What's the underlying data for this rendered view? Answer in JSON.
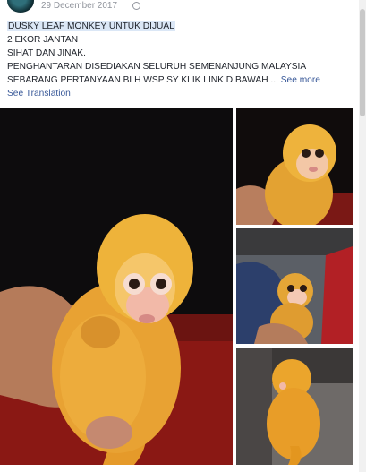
{
  "header": {
    "date": "29 December 2017",
    "date_suffix": "·"
  },
  "post": {
    "title": "DUSKY LEAF MONKEY UNTUK DIJUAL",
    "line2": "2 EKOR JANTAN",
    "line3": "SIHAT DAN JINAK.",
    "line4": "PENGHANTARAN DISEDIAKAN SELURUH SEMENANJUNG MALAYSIA",
    "line5": "SEBARANG PERTANYAAN BLH WSP SY KLIK LINK DIBAWAH ...",
    "see_more": "See more",
    "see_translation": "See Translation"
  },
  "photos": [
    {
      "name": "main-photo",
      "subject": "golden dusky leaf monkey held in hand"
    },
    {
      "name": "photo-2",
      "subject": "monkey close-up"
    },
    {
      "name": "photo-3",
      "subject": "monkey held in car"
    },
    {
      "name": "photo-4",
      "subject": "monkey from behind"
    }
  ]
}
